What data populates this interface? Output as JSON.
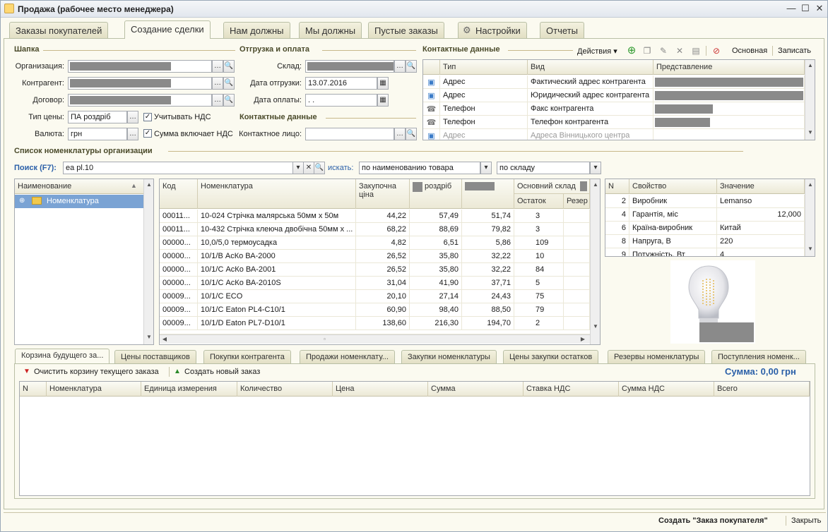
{
  "window": {
    "title": "Продажа (рабочее место менеджера)",
    "minimize": "—",
    "maximize": "☐",
    "close": "✕"
  },
  "tabs": [
    "Заказы покупателей",
    "Создание сделки",
    "Нам должны",
    "Мы должны",
    "Пустые заказы",
    "Настройки",
    "Отчеты"
  ],
  "shapka": {
    "title": "Шапка",
    "org_label": "Организация:",
    "contractor_label": "Контрагент:",
    "contract_label": "Договор:",
    "price_type_label": "Тип цены:",
    "price_type_value": "ПА роздріб",
    "currency_label": "Валюта:",
    "currency_value": "грн",
    "vat_check_label": "Учитывать НДС",
    "vat_incl_label": "Сумма включает НДС"
  },
  "shipping": {
    "title": "Отгрузка и оплата",
    "warehouse_label": "Склад:",
    "ship_date_label": "Дата отгрузки:",
    "ship_date_value": "13.07.2016",
    "pay_date_label": "Дата оплаты:",
    "pay_date_value": " .  .",
    "contacts_title": "Контактные данные",
    "contact_person_label": "Контактное лицо:"
  },
  "contacts": {
    "title": "Контактные данные",
    "actions_label": "Действия ▾",
    "main_label": "Основная",
    "save_label": "Записать",
    "headers": [
      "Тип",
      "Вид",
      "Представление"
    ],
    "rows": [
      {
        "type": "Адрес",
        "kind": "Фактический адрес контрагента",
        "icon": "address-icon"
      },
      {
        "type": "Адрес",
        "kind": "Юридический адрес контрагента",
        "icon": "address-icon"
      },
      {
        "type": "Телефон",
        "kind": "Факс контрагента",
        "icon": "phone-icon"
      },
      {
        "type": "Телефон",
        "kind": "Телефон контрагента",
        "icon": "phone-icon"
      },
      {
        "type": "Адрес",
        "kind": "Адреса Вінницького центра",
        "icon": "address-icon"
      }
    ]
  },
  "nomenclature": {
    "title": "Список номенклатуры организации",
    "search_label": "Поиск (F7):",
    "search_value": "ea pl.10",
    "search_in_label": "искать:",
    "search_mode": "по наименованию товара",
    "warehouse_mode": "по складу",
    "tree_header": "Наименование",
    "tree_item": "Номенклатура",
    "headers": {
      "code": "Код",
      "name": "Номенклатура",
      "purchase": "Закупочна ціна",
      "retail": "роздріб",
      "warehouse": "Основний склад",
      "stock": "Остаток",
      "reserve": "Резер"
    },
    "rows": [
      {
        "code": "00011...",
        "name": "10-024 Стрічка малярська 50мм х 50м",
        "purchase": "44,22",
        "retail": "57,49",
        "price2": "51,74",
        "stock": "3"
      },
      {
        "code": "00011...",
        "name": "10-432 Стрічка клеюча двобічна 50мм х ...",
        "purchase": "68,22",
        "retail": "88,69",
        "price2": "79,82",
        "stock": "3"
      },
      {
        "code": "00000...",
        "name": "10,0/5,0 термоусадка",
        "purchase": "4,82",
        "retail": "6,51",
        "price2": "5,86",
        "stock": "109"
      },
      {
        "code": "00000...",
        "name": "10/1/В АсКо ВА-2000",
        "purchase": "26,52",
        "retail": "35,80",
        "price2": "32,22",
        "stock": "10"
      },
      {
        "code": "00000...",
        "name": "10/1/С АсКо ВА-2001",
        "purchase": "26,52",
        "retail": "35,80",
        "price2": "32,22",
        "stock": "84"
      },
      {
        "code": "00000...",
        "name": "10/1/С АсКо ВА-2010S",
        "purchase": "31,04",
        "retail": "41,90",
        "price2": "37,71",
        "stock": "5"
      },
      {
        "code": "00009...",
        "name": "10/1/С ECO",
        "purchase": "20,10",
        "retail": "27,14",
        "price2": "24,43",
        "stock": "75"
      },
      {
        "code": "00009...",
        "name": "10/1/С Eaton PL4-C10/1",
        "purchase": "60,90",
        "retail": "98,40",
        "price2": "88,50",
        "stock": "79"
      },
      {
        "code": "00009...",
        "name": "10/1/D Eaton PL7-D10/1",
        "purchase": "138,60",
        "retail": "216,30",
        "price2": "194,70",
        "stock": "2"
      }
    ]
  },
  "properties": {
    "headers": [
      "N",
      "Свойство",
      "Значение"
    ],
    "rows": [
      {
        "n": "2",
        "prop": "Виробник",
        "value": "Lemanso",
        "align": "left"
      },
      {
        "n": "4",
        "prop": "Гарантія, міс",
        "value": "12,000",
        "align": "right"
      },
      {
        "n": "6",
        "prop": "Країна-виробник",
        "value": "Китай",
        "align": "left"
      },
      {
        "n": "8",
        "prop": "Напруга, В",
        "value": "220",
        "align": "left"
      },
      {
        "n": "9",
        "prop": "Потужність, Вт",
        "value": "4",
        "align": "left"
      }
    ]
  },
  "bottom_tabs": [
    "Корзина будущего за...",
    "Цены поставщиков",
    "Покупки контрагента",
    "Продажи номенклату...",
    "Закупки номенклатуры",
    "Цены закупки остатков",
    "Резервы номенклатуры",
    "Поступления номенк..."
  ],
  "cart": {
    "clear_label": "Очистить корзину текущего заказа",
    "new_order_label": "Создать новый заказ",
    "sum_label": "Сумма: 0,00 грн",
    "headers": [
      "N",
      "Номенклатура",
      "Единица измерения",
      "Количество",
      "Цена",
      "Сумма",
      "Ставка НДС",
      "Сумма НДС",
      "Всего"
    ]
  },
  "footer": {
    "create_order_label": "Создать \"Заказ покупателя\"",
    "close_label": "Закрыть"
  }
}
